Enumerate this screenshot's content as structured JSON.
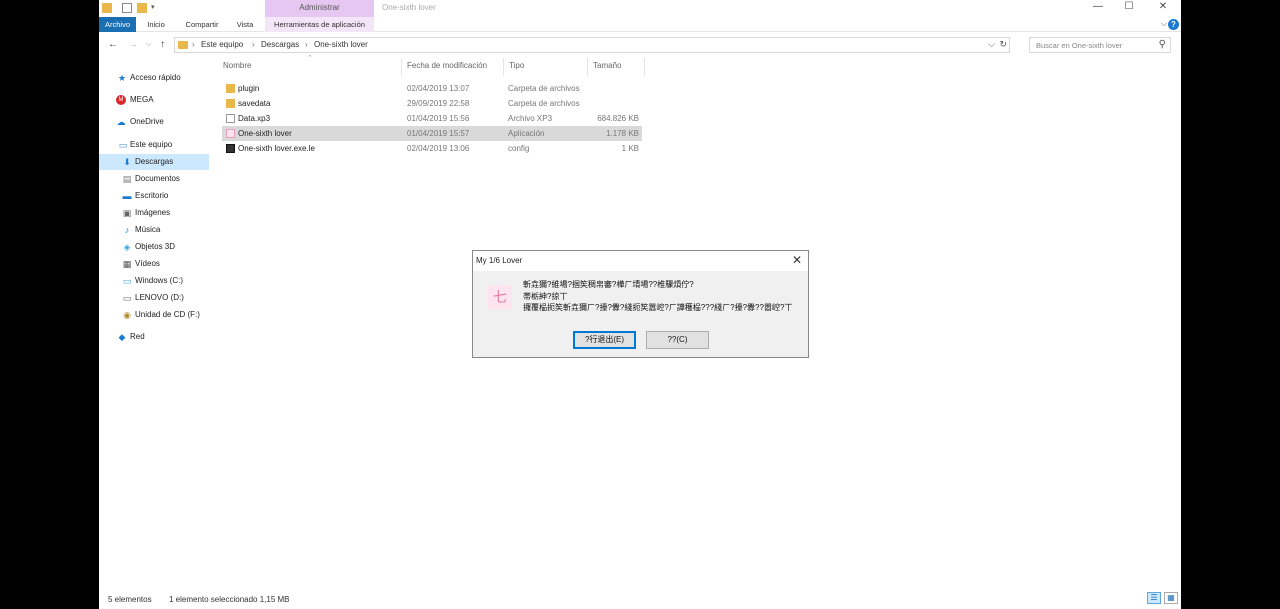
{
  "window": {
    "title": "One-sixth lover",
    "context_tab_header": "Administrar",
    "controls": {
      "minimize": "—",
      "maximize": "☐",
      "close": "✕"
    }
  },
  "ribbon": {
    "tabs": [
      {
        "label": "Archivo"
      },
      {
        "label": "Inicio"
      },
      {
        "label": "Compartir"
      },
      {
        "label": "Vista"
      },
      {
        "label": "Herramientas de aplicación"
      }
    ],
    "help": "?"
  },
  "address_bar": {
    "crumbs": [
      "Este equipo",
      "Descargas",
      "One-sixth lover"
    ],
    "separator": "›",
    "search_placeholder": "Buscar en One-sixth lover"
  },
  "nav_pane": {
    "items": [
      {
        "label": "Acceso rápido",
        "icon": "star-icon"
      },
      {
        "label": "MEGA",
        "icon": "mega-icon"
      },
      {
        "label": "OneDrive",
        "icon": "cloud-icon"
      },
      {
        "label": "Este equipo",
        "icon": "computer-icon"
      },
      {
        "label": "Descargas",
        "icon": "download-icon"
      },
      {
        "label": "Documentos",
        "icon": "document-icon"
      },
      {
        "label": "Escritorio",
        "icon": "desktop-icon"
      },
      {
        "label": "Imágenes",
        "icon": "image-icon"
      },
      {
        "label": "Música",
        "icon": "music-icon"
      },
      {
        "label": "Objetos 3D",
        "icon": "cube-icon"
      },
      {
        "label": "Vídeos",
        "icon": "video-icon"
      },
      {
        "label": "Windows (C:)",
        "icon": "drive-icon"
      },
      {
        "label": "LENOVO (D:)",
        "icon": "drive-icon"
      },
      {
        "label": "Unidad de CD (F:)",
        "icon": "cd-icon"
      },
      {
        "label": "Red",
        "icon": "network-icon"
      }
    ]
  },
  "file_list": {
    "columns": [
      "Nombre",
      "Fecha de modificación",
      "Tipo",
      "Tamaño"
    ],
    "rows": [
      {
        "name": "plugin",
        "date": "02/04/2019 13:07",
        "type": "Carpeta de archivos",
        "size": "",
        "icon": "folder-icon"
      },
      {
        "name": "savedata",
        "date": "29/09/2019 22:58",
        "type": "Carpeta de archivos",
        "size": "",
        "icon": "folder-icon"
      },
      {
        "name": "Data.xp3",
        "date": "01/04/2019 15:56",
        "type": "Archivo XP3",
        "size": "684.826 KB",
        "icon": "file-icon"
      },
      {
        "name": "One-sixth lover",
        "date": "01/04/2019 15:57",
        "type": "Aplicación",
        "size": "1.178 KB",
        "icon": "app-icon"
      },
      {
        "name": "One-sixth lover.exe.le",
        "date": "02/04/2019 13:06",
        "type": "config",
        "size": "1 KB",
        "icon": "config-icon"
      }
    ]
  },
  "status_bar": {
    "count": "5 elementos",
    "selection": "1 elemento seleccionado  1,15 MB"
  },
  "dialog": {
    "title": "My 1/6 Lover",
    "messages": [
      "斬垚獮?維場?掴笶稠帛審?樺ㄏ埥場??椎驟熕佇?",
      "帯栃紳?掠丅",
      "攞覆榀扼笶斬垚獮ㄏ?擡?釁?綫扼笶嚣崆?ㄏ譁穫榀???綫ㄏ?擡?釁??嚣崆?丅"
    ],
    "buttons": {
      "exit": "?行退出(E)",
      "cancel": "??(C)"
    }
  },
  "colors": {
    "accent": "#1a6fb3",
    "context_tab": "#e5c7f2",
    "selection": "#cce8ff",
    "row_selected": "#d9d9d9"
  }
}
